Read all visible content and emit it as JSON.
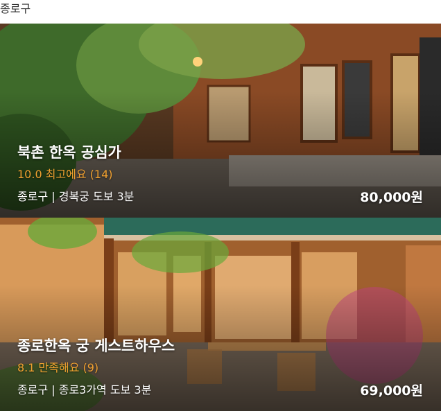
{
  "region_header": "종로구",
  "listings": [
    {
      "title": "북촌 한옥 공심가",
      "rating": "10.0 최고에요 (14)",
      "location": "종로구 | 경복궁 도보 3분",
      "price": "80,000원"
    },
    {
      "title": "종로한옥 궁 게스트하우스",
      "rating": "8.1 만족해요 (9)",
      "location": "종로구 | 종로3가역 도보 3분",
      "price": "69,000원"
    }
  ],
  "colors": {
    "rating": "#f0a030",
    "text": "#ffffff"
  }
}
